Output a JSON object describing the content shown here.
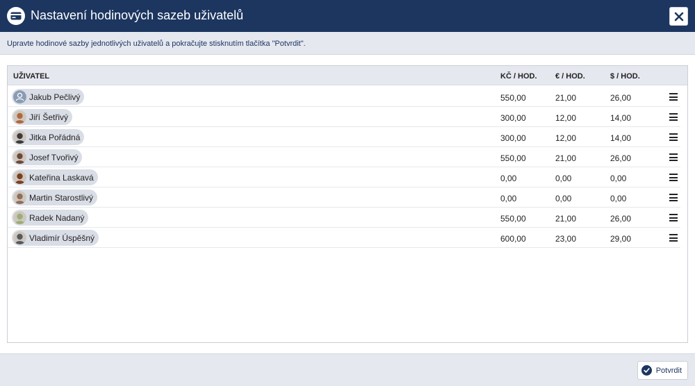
{
  "dialog": {
    "title": "Nastavení hodinových sazeb uživatelů",
    "title_icon": "credit-card-icon",
    "close_icon": "close-icon",
    "instruction": "Upravte hodinové sazby jednotlivých uživatelů a pokračujte stisknutím tlačítka \"Potvrdit\"."
  },
  "table": {
    "columns": [
      "UŽIVATEL",
      "KČ / HOD.",
      "€ / HOD.",
      "$ / HOD."
    ],
    "rows": [
      {
        "name": "Jakub Pečlivý",
        "czk": "550,00",
        "eur": "21,00",
        "usd": "26,00",
        "avatar": "default-user-icon",
        "avatar_color": "#8a9bb4"
      },
      {
        "name": "Jiří Šetřivý",
        "czk": "300,00",
        "eur": "12,00",
        "usd": "14,00",
        "avatar": "photo-avatar",
        "avatar_color": "#b0683f"
      },
      {
        "name": "Jitka Pořádná",
        "czk": "300,00",
        "eur": "12,00",
        "usd": "14,00",
        "avatar": "photo-avatar",
        "avatar_color": "#3b3b3b"
      },
      {
        "name": "Josef Tvořivý",
        "czk": "550,00",
        "eur": "21,00",
        "usd": "26,00",
        "avatar": "photo-avatar",
        "avatar_color": "#6b4a3a"
      },
      {
        "name": "Kateřina Laskavá",
        "czk": "0,00",
        "eur": "0,00",
        "usd": "0,00",
        "avatar": "photo-avatar",
        "avatar_color": "#7a3f22"
      },
      {
        "name": "Martin Starostlivý",
        "czk": "0,00",
        "eur": "0,00",
        "usd": "0,00",
        "avatar": "photo-avatar",
        "avatar_color": "#8f6e5a"
      },
      {
        "name": "Radek Nadaný",
        "czk": "550,00",
        "eur": "21,00",
        "usd": "26,00",
        "avatar": "photo-avatar",
        "avatar_color": "#9cad7a"
      },
      {
        "name": "Vladimír Úspěšný",
        "czk": "600,00",
        "eur": "23,00",
        "usd": "29,00",
        "avatar": "photo-avatar",
        "avatar_color": "#555a5e"
      }
    ],
    "row_menu_icon": "hamburger-menu-icon"
  },
  "footer": {
    "confirm_label": "Potvrdit",
    "confirm_icon": "check-circle-icon"
  },
  "colors": {
    "header_bg": "#1c3660",
    "chip_bg": "#d9dde5",
    "page_bg": "#e5e8ef"
  }
}
